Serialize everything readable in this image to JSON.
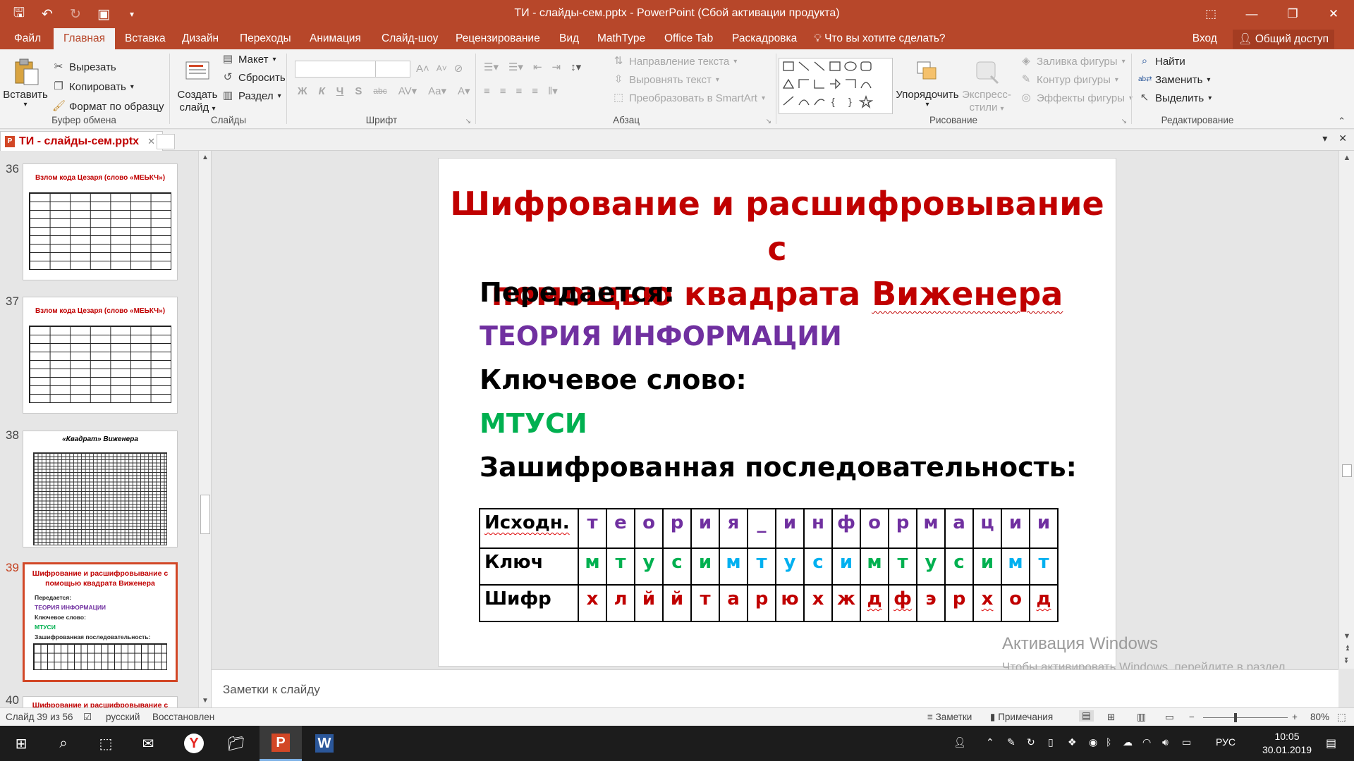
{
  "window": {
    "title": "ТИ - слайды-сем.pptx - PowerPoint (Сбой активации продукта)",
    "qat_icons": [
      "save-icon",
      "undo-icon",
      "redo-icon",
      "present-icon",
      "customize-icon"
    ],
    "controls": [
      "ribbon-display-icon",
      "minimize-icon",
      "maximize-icon",
      "close-icon"
    ]
  },
  "menu": {
    "tabs": [
      "Файл",
      "Главная",
      "Вставка",
      "Дизайн",
      "Переходы",
      "Анимация",
      "Слайд-шоу",
      "Рецензирование",
      "Вид",
      "MathType",
      "Office Tab",
      "Раскадровка"
    ],
    "tell_me": "Что вы хотите сделать?",
    "login": "Вход",
    "share": "Общий доступ"
  },
  "ribbon": {
    "clipboard": {
      "paste": "Вставить",
      "cut": "Вырезать",
      "copy": "Копировать",
      "format_painter": "Формат по образцу",
      "label": "Буфер обмена"
    },
    "slides": {
      "new_slide": "Создать",
      "new_slide2": "слайд",
      "layout": "Макет",
      "reset": "Сбросить",
      "section": "Раздел",
      "label": "Слайды"
    },
    "font": {
      "label": "Шрифт",
      "bold": "Ж",
      "italic": "К",
      "underline": "Ч",
      "strike": "S",
      "abc": "abc"
    },
    "paragraph": {
      "text_direction": "Направление текста",
      "align_text": "Выровнять текст",
      "smartart": "Преобразовать в SmartArt",
      "label": "Абзац"
    },
    "drawing": {
      "arrange": "Упорядочить",
      "quick_styles": "Экспресс-",
      "quick_styles2": "стили",
      "fill": "Заливка фигуры",
      "outline": "Контур фигуры",
      "effects": "Эффекты фигуры",
      "label": "Рисование"
    },
    "editing": {
      "find": "Найти",
      "replace": "Заменить",
      "select": "Выделить",
      "label": "Редактирование"
    }
  },
  "doc_tab": {
    "name": "ТИ - слайды-сем.pptx"
  },
  "thumbnails": [
    {
      "num": "36",
      "title": "Взлом кода Цезаря (слово «МЕЬКЧ»)"
    },
    {
      "num": "37",
      "title": "Взлом кода Цезаря (слово «МЕЬКЧ»)"
    },
    {
      "num": "38",
      "title": "«Квадрат» Виженера"
    },
    {
      "num": "39",
      "title": "Шифрование и расшифровывание с помощью квадрата  Виженера",
      "lines": [
        "Передается:",
        "ТЕОРИЯ ИНФОРМАЦИИ",
        "Ключевое слово:",
        "МТУСИ",
        "Зашифрованная последовательность:"
      ]
    },
    {
      "num": "40",
      "title": "Шифрование и расшифровывание с"
    }
  ],
  "slide": {
    "title_line1": "Шифрование и расшифровывание с",
    "title_line2a": "помощью квадрата ",
    "title_line2b": "Виженера",
    "transmitted_label": "Передается:",
    "transmitted_value": "ТЕОРИЯ ИНФОРМАЦИИ",
    "keyword_label": "Ключевое слово:",
    "keyword_value": "МТУСИ",
    "cipher_label": "Зашифрованная последовательность:",
    "table": {
      "row_labels": [
        "Исходн.",
        "Ключ",
        "Шифр"
      ],
      "source": [
        "т",
        "е",
        "о",
        "р",
        "и",
        "я",
        "_",
        "и",
        "н",
        "ф",
        "о",
        "р",
        "м",
        "а",
        "ц",
        "и",
        "и"
      ],
      "key": [
        "м",
        "т",
        "у",
        "с",
        "и",
        "м",
        "т",
        "у",
        "с",
        "и",
        "м",
        "т",
        "у",
        "с",
        "и",
        "м",
        "т"
      ],
      "cipher": [
        "х",
        "л",
        "й",
        "й",
        "т",
        "а",
        "р",
        "ю",
        "х",
        "ж",
        "д",
        "ф",
        "э",
        "р",
        "х",
        "о",
        "д"
      ],
      "key_colors": [
        "#00b050",
        "#00b050",
        "#00b050",
        "#00b050",
        "#00b050",
        "#00b0f0",
        "#00b0f0",
        "#00b0f0",
        "#00b0f0",
        "#00b0f0",
        "#00b050",
        "#00b050",
        "#00b050",
        "#00b050",
        "#00b050",
        "#00b0f0",
        "#00b0f0"
      ]
    }
  },
  "watermark": {
    "title": "Активация Windows",
    "text": "Чтобы активировать Windows, перейдите в раздел \"Параметры\"."
  },
  "notes": {
    "placeholder": "Заметки к слайду"
  },
  "status": {
    "slide_info": "Слайд 39 из 56",
    "language": "русский",
    "state": "Восстановлен",
    "notes_btn": "Заметки",
    "comments_btn": "Примечания",
    "zoom": "80%"
  },
  "taskbar": {
    "lang": "РУС",
    "time": "10:05",
    "date": "30.01.2019"
  },
  "colors": {
    "accent": "#b7472a",
    "slide_title": "#c00000",
    "purple": "#7030a0",
    "green": "#00b050",
    "cyan": "#00b0f0"
  }
}
